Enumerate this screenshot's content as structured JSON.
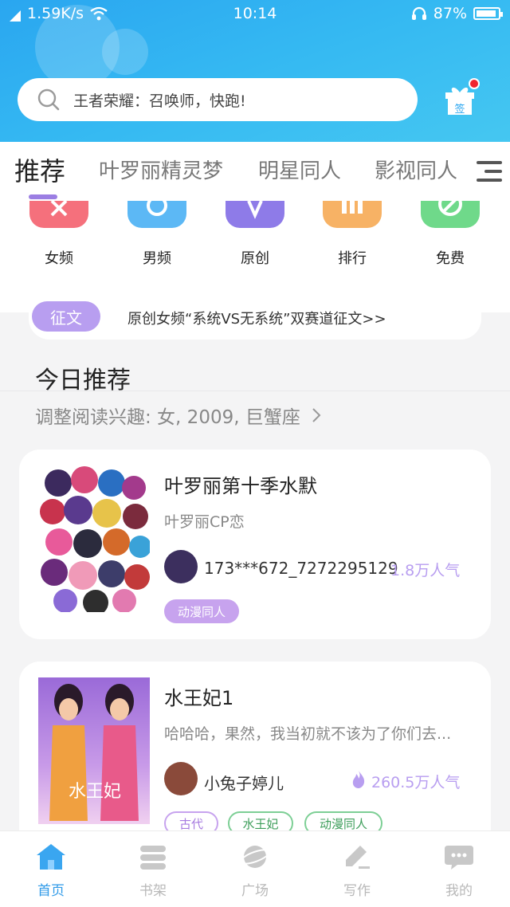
{
  "status_bar": {
    "speed": "1.59K/s",
    "time": "10:14",
    "battery": "87%"
  },
  "search": {
    "placeholder": "王者荣耀：召唤师，快跑!"
  },
  "gift": {
    "label": "签"
  },
  "tabs": [
    "推荐",
    "叶罗丽精灵梦",
    "明星同人",
    "影视同人"
  ],
  "categories": [
    {
      "label": "女频",
      "color": "#f5707c"
    },
    {
      "label": "男频",
      "color": "#5cb8f5"
    },
    {
      "label": "原创",
      "color": "#8e7be8"
    },
    {
      "label": "排行",
      "color": "#f7b265"
    },
    {
      "label": "免费",
      "color": "#6fd98a"
    }
  ],
  "banner": {
    "tag": "征文",
    "text": "原创女频“系统VS无系统”双赛道征文>>"
  },
  "section": {
    "title": "今日推荐",
    "subtitle": "调整阅读兴趣: 女, 2009, 巨蟹座"
  },
  "books": [
    {
      "title": "叶罗丽第十季水默",
      "desc": "叶罗丽CP恋",
      "author": "173***672_7272295129",
      "popularity": "1.8万人气",
      "tags": [
        "动漫同人"
      ]
    },
    {
      "title": "水王妃1",
      "desc": "哈哈哈，果然，我当初就不该为了你们去...",
      "author": "小兔子婷儿",
      "popularity": "260.5万人气",
      "tags": [
        "古代",
        "水王妃",
        "动漫同人"
      ]
    }
  ],
  "bottom_nav": [
    "首页",
    "书架",
    "广场",
    "写作",
    "我的"
  ],
  "colors": {
    "accent": "#2f9ae8",
    "purple": "#b89ef0",
    "header": "#35b9f2"
  }
}
